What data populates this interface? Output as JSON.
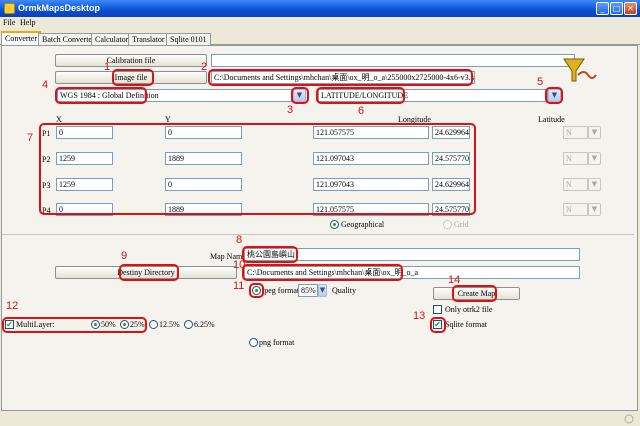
{
  "window": {
    "title": "OrmkMapsDesktop"
  },
  "menu": {
    "file": "File",
    "help": "Help"
  },
  "tabs": [
    "Converter",
    "Batch Converter",
    "Calculator",
    "Translator",
    "Sqlite 0101"
  ],
  "converter": {
    "calibration_label": "Calibration file",
    "calibration_value": "",
    "image_label": "Image file",
    "image_value": "C:\\Documents and Settings\\mhchan\\桌面\\ox_明_o_a\\255000x2725000-4x6-v3.tag.png",
    "datum": "WGS 1984 : Global Definition",
    "coord_format": "LATITUDE/LONGITUDE",
    "headers": {
      "x": "X",
      "y": "Y",
      "longitude": "Longitude",
      "latitude": "Latitude"
    },
    "points": [
      {
        "label": "P1",
        "x": "0",
        "y": "0",
        "longitude": "121.057575",
        "latitude": "24.629964",
        "hemi": "N"
      },
      {
        "label": "P2",
        "x": "1259",
        "y": "1889",
        "longitude": "121.097043",
        "latitude": "24.575770",
        "hemi": "N"
      },
      {
        "label": "P3",
        "x": "1259",
        "y": "0",
        "longitude": "121.097043",
        "latitude": "24.629964",
        "hemi": "N"
      },
      {
        "label": "P4",
        "x": "0",
        "y": "1889",
        "longitude": "121.057575",
        "latitude": "24.575770",
        "hemi": "N"
      }
    ],
    "geographical_label": "Geographical",
    "grid_label": "Grid",
    "map_name_label": "Map Name",
    "map_name_value": "桃公園島嶼山",
    "destiny_label": "Destiny Directory",
    "destiny_value": "C:\\Documents and Settings\\mhchan\\桌面\\ox_明_o_a",
    "jpeg_format_label": "jpeg format",
    "quality_value": "85%",
    "quality_label": "Quality",
    "create_map_label": "Create Map",
    "only_otrk2_label": "Only otrk2 file",
    "sqlite_format_label": "Sqlite format",
    "multilayer_label": "MultiLayer:",
    "scale_options": [
      "50%",
      "25%",
      "12.5%",
      "6.25%"
    ],
    "png_format_label": "png format"
  },
  "annotations": [
    "1",
    "2",
    "3",
    "4",
    "5",
    "6",
    "7",
    "8",
    "9",
    "10",
    "11",
    "12",
    "13",
    "14"
  ],
  "colors": {
    "annotation": "#e01010",
    "titlebar": "#0a4fd3",
    "window_bg": "#ece9d8"
  }
}
